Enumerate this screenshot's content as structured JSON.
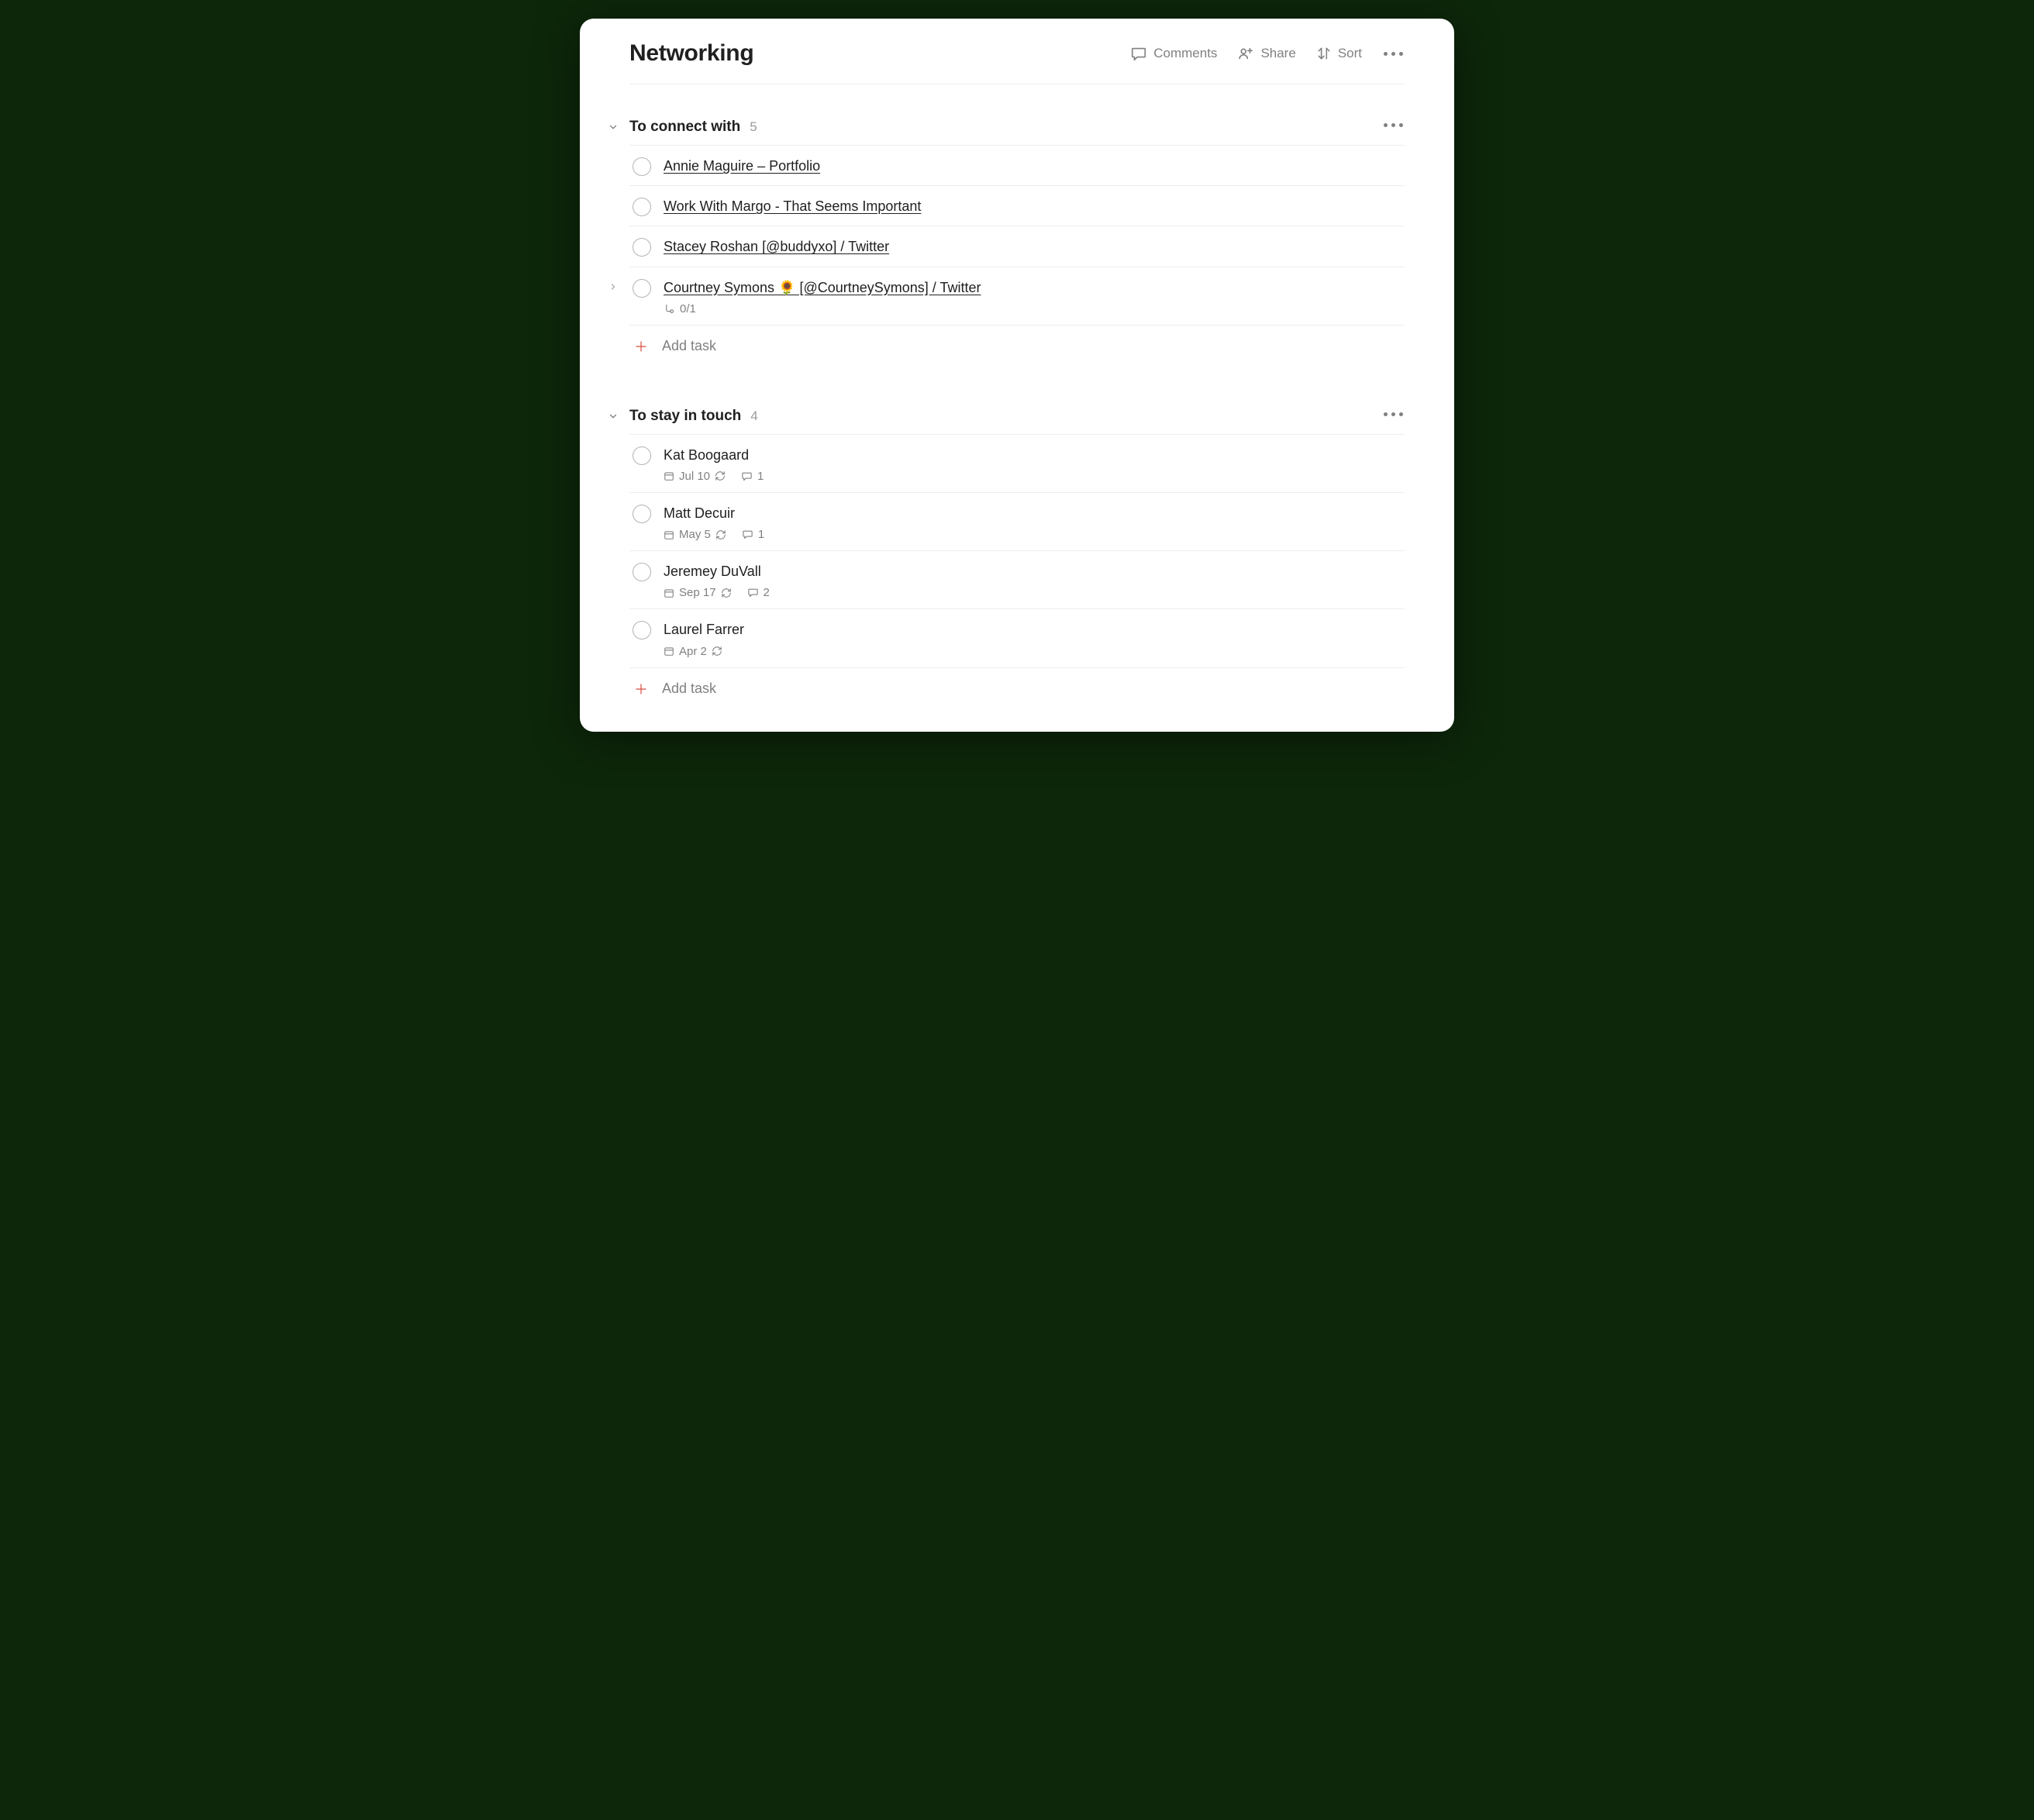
{
  "page": {
    "title": "Networking"
  },
  "toolbar": {
    "comments": "Comments",
    "share": "Share",
    "sort": "Sort"
  },
  "sections": [
    {
      "title": "To connect with",
      "count": "5",
      "add_label": "Add task",
      "tasks": [
        {
          "title": "Annie Maguire – Portfolio",
          "link": true
        },
        {
          "title": "Work With Margo - That Seems Important",
          "link": true
        },
        {
          "title": "Stacey Roshan [@buddyxo] / Twitter",
          "link": true
        },
        {
          "title": "Courtney Symons 🌻 [@CourtneySymons] / Twitter",
          "link": true,
          "has_subtasks": true,
          "subtasks": "0/1"
        }
      ]
    },
    {
      "title": "To stay in touch",
      "count": "4",
      "add_label": "Add task",
      "tasks": [
        {
          "title": "Kat Boogaard",
          "date": "Jul 10",
          "recurring": true,
          "comments": "1"
        },
        {
          "title": "Matt Decuir",
          "date": "May 5",
          "recurring": true,
          "comments": "1"
        },
        {
          "title": "Jeremey DuVall",
          "date": "Sep 17",
          "recurring": true,
          "comments": "2"
        },
        {
          "title": "Laurel Farrer",
          "date": "Apr 2",
          "recurring": true
        }
      ]
    }
  ]
}
